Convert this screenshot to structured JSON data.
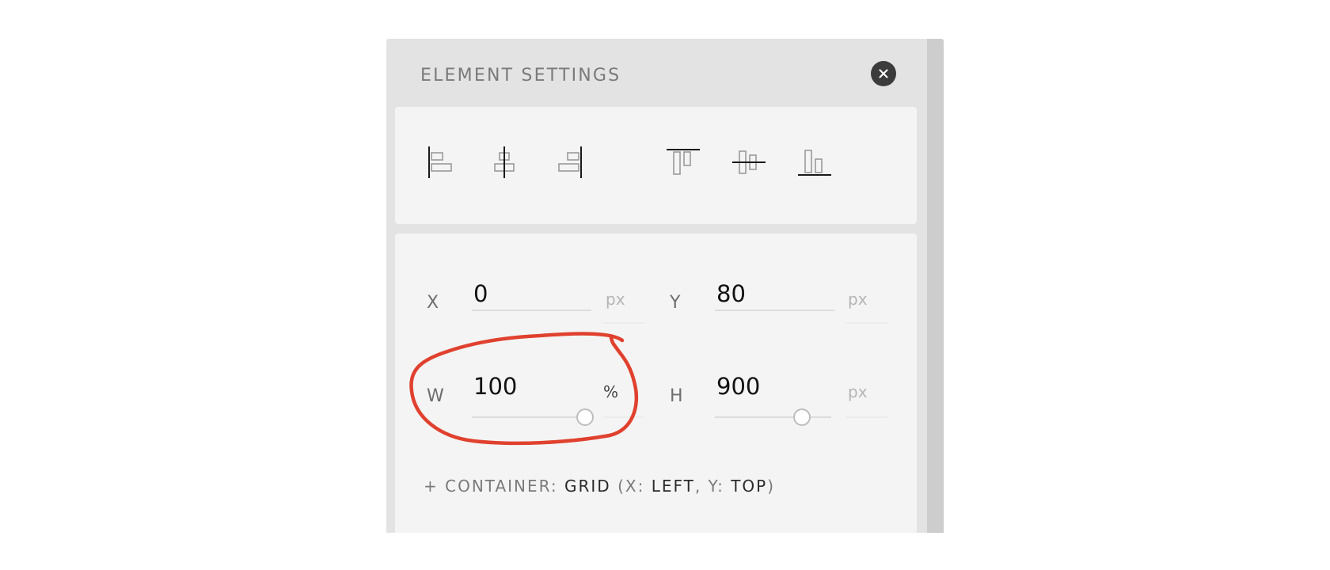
{
  "panel": {
    "title": "ELEMENT SETTINGS",
    "close_icon": "close-icon"
  },
  "alignment": {
    "buttons": [
      {
        "name": "align-left",
        "icon": "align-left-icon"
      },
      {
        "name": "align-center-horizontal",
        "icon": "align-center-horizontal-icon"
      },
      {
        "name": "align-right",
        "icon": "align-right-icon"
      },
      {
        "name": "align-top",
        "icon": "align-top-icon"
      },
      {
        "name": "align-middle-vertical",
        "icon": "align-middle-vertical-icon"
      },
      {
        "name": "align-bottom",
        "icon": "align-bottom-icon"
      }
    ]
  },
  "geometry": {
    "x": {
      "label": "X",
      "value": "0",
      "unit": "px"
    },
    "y": {
      "label": "Y",
      "value": "80",
      "unit": "px"
    },
    "w": {
      "label": "W",
      "value": "100",
      "unit": "%",
      "slider_level": 0.97
    },
    "h": {
      "label": "H",
      "value": "900",
      "unit": "px",
      "slider_level": 0.75
    }
  },
  "container": {
    "prefix": "+ CONTAINER:",
    "type": "GRID",
    "open_paren": "(X:",
    "x_value": "LEFT",
    "comma": ", Y:",
    "y_value": "TOP",
    "close_paren": ")"
  },
  "colors": {
    "annotation": "#e0412e",
    "close_button": "#3c3c3c",
    "panel_bg": "#e3e3e3",
    "card_bg": "#f4f4f4"
  }
}
